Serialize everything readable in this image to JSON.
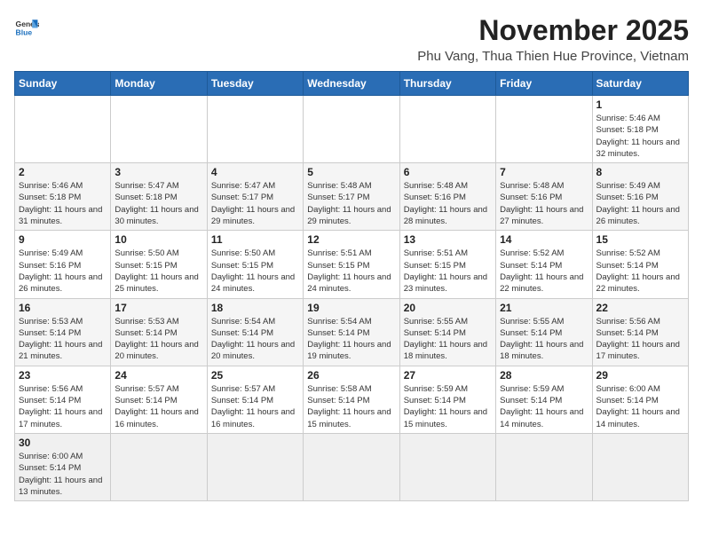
{
  "logo": {
    "line1": "General",
    "line2": "Blue"
  },
  "title": "November 2025",
  "subtitle": "Phu Vang, Thua Thien Hue Province, Vietnam",
  "weekdays": [
    "Sunday",
    "Monday",
    "Tuesday",
    "Wednesday",
    "Thursday",
    "Friday",
    "Saturday"
  ],
  "weeks": [
    [
      {
        "day": "",
        "info": ""
      },
      {
        "day": "",
        "info": ""
      },
      {
        "day": "",
        "info": ""
      },
      {
        "day": "",
        "info": ""
      },
      {
        "day": "",
        "info": ""
      },
      {
        "day": "",
        "info": ""
      },
      {
        "day": "1",
        "info": "Sunrise: 5:46 AM\nSunset: 5:18 PM\nDaylight: 11 hours\nand 32 minutes."
      }
    ],
    [
      {
        "day": "2",
        "info": "Sunrise: 5:46 AM\nSunset: 5:18 PM\nDaylight: 11 hours\nand 31 minutes."
      },
      {
        "day": "3",
        "info": "Sunrise: 5:47 AM\nSunset: 5:18 PM\nDaylight: 11 hours\nand 30 minutes."
      },
      {
        "day": "4",
        "info": "Sunrise: 5:47 AM\nSunset: 5:17 PM\nDaylight: 11 hours\nand 29 minutes."
      },
      {
        "day": "5",
        "info": "Sunrise: 5:48 AM\nSunset: 5:17 PM\nDaylight: 11 hours\nand 29 minutes."
      },
      {
        "day": "6",
        "info": "Sunrise: 5:48 AM\nSunset: 5:16 PM\nDaylight: 11 hours\nand 28 minutes."
      },
      {
        "day": "7",
        "info": "Sunrise: 5:48 AM\nSunset: 5:16 PM\nDaylight: 11 hours\nand 27 minutes."
      },
      {
        "day": "8",
        "info": "Sunrise: 5:49 AM\nSunset: 5:16 PM\nDaylight: 11 hours\nand 26 minutes."
      }
    ],
    [
      {
        "day": "9",
        "info": "Sunrise: 5:49 AM\nSunset: 5:16 PM\nDaylight: 11 hours\nand 26 minutes."
      },
      {
        "day": "10",
        "info": "Sunrise: 5:50 AM\nSunset: 5:15 PM\nDaylight: 11 hours\nand 25 minutes."
      },
      {
        "day": "11",
        "info": "Sunrise: 5:50 AM\nSunset: 5:15 PM\nDaylight: 11 hours\nand 24 minutes."
      },
      {
        "day": "12",
        "info": "Sunrise: 5:51 AM\nSunset: 5:15 PM\nDaylight: 11 hours\nand 24 minutes."
      },
      {
        "day": "13",
        "info": "Sunrise: 5:51 AM\nSunset: 5:15 PM\nDaylight: 11 hours\nand 23 minutes."
      },
      {
        "day": "14",
        "info": "Sunrise: 5:52 AM\nSunset: 5:14 PM\nDaylight: 11 hours\nand 22 minutes."
      },
      {
        "day": "15",
        "info": "Sunrise: 5:52 AM\nSunset: 5:14 PM\nDaylight: 11 hours\nand 22 minutes."
      }
    ],
    [
      {
        "day": "16",
        "info": "Sunrise: 5:53 AM\nSunset: 5:14 PM\nDaylight: 11 hours\nand 21 minutes."
      },
      {
        "day": "17",
        "info": "Sunrise: 5:53 AM\nSunset: 5:14 PM\nDaylight: 11 hours\nand 20 minutes."
      },
      {
        "day": "18",
        "info": "Sunrise: 5:54 AM\nSunset: 5:14 PM\nDaylight: 11 hours\nand 20 minutes."
      },
      {
        "day": "19",
        "info": "Sunrise: 5:54 AM\nSunset: 5:14 PM\nDaylight: 11 hours\nand 19 minutes."
      },
      {
        "day": "20",
        "info": "Sunrise: 5:55 AM\nSunset: 5:14 PM\nDaylight: 11 hours\nand 18 minutes."
      },
      {
        "day": "21",
        "info": "Sunrise: 5:55 AM\nSunset: 5:14 PM\nDaylight: 11 hours\nand 18 minutes."
      },
      {
        "day": "22",
        "info": "Sunrise: 5:56 AM\nSunset: 5:14 PM\nDaylight: 11 hours\nand 17 minutes."
      }
    ],
    [
      {
        "day": "23",
        "info": "Sunrise: 5:56 AM\nSunset: 5:14 PM\nDaylight: 11 hours\nand 17 minutes."
      },
      {
        "day": "24",
        "info": "Sunrise: 5:57 AM\nSunset: 5:14 PM\nDaylight: 11 hours\nand 16 minutes."
      },
      {
        "day": "25",
        "info": "Sunrise: 5:57 AM\nSunset: 5:14 PM\nDaylight: 11 hours\nand 16 minutes."
      },
      {
        "day": "26",
        "info": "Sunrise: 5:58 AM\nSunset: 5:14 PM\nDaylight: 11 hours\nand 15 minutes."
      },
      {
        "day": "27",
        "info": "Sunrise: 5:59 AM\nSunset: 5:14 PM\nDaylight: 11 hours\nand 15 minutes."
      },
      {
        "day": "28",
        "info": "Sunrise: 5:59 AM\nSunset: 5:14 PM\nDaylight: 11 hours\nand 14 minutes."
      },
      {
        "day": "29",
        "info": "Sunrise: 6:00 AM\nSunset: 5:14 PM\nDaylight: 11 hours\nand 14 minutes."
      }
    ],
    [
      {
        "day": "30",
        "info": "Sunrise: 6:00 AM\nSunset: 5:14 PM\nDaylight: 11 hours\nand 13 minutes."
      },
      {
        "day": "",
        "info": ""
      },
      {
        "day": "",
        "info": ""
      },
      {
        "day": "",
        "info": ""
      },
      {
        "day": "",
        "info": ""
      },
      {
        "day": "",
        "info": ""
      },
      {
        "day": "",
        "info": ""
      }
    ]
  ]
}
